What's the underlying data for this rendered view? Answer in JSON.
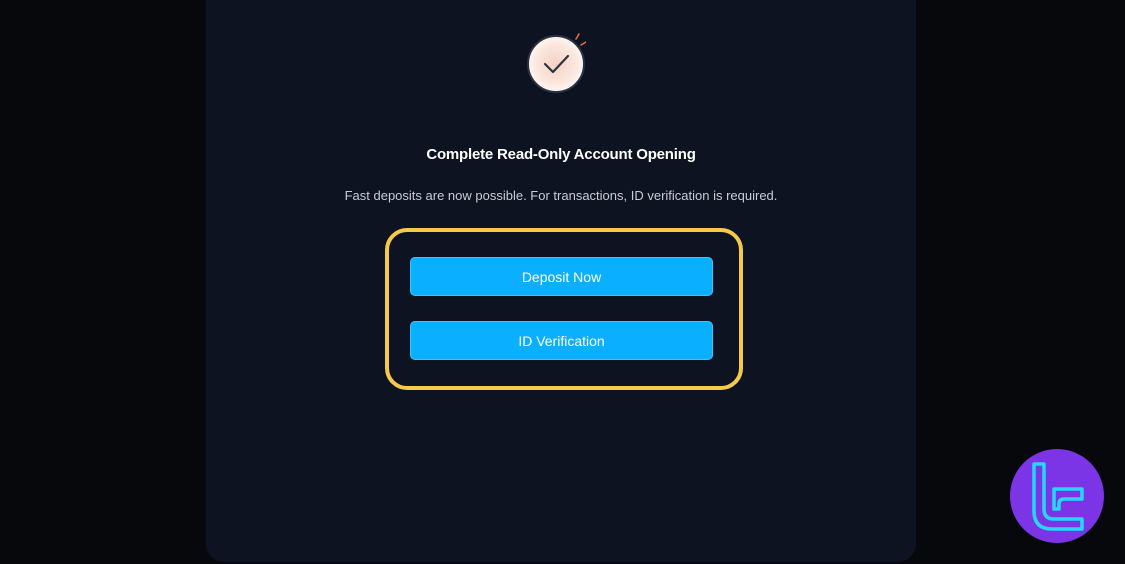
{
  "dialog": {
    "title": "Complete Read-Only Account Opening",
    "message": "Fast deposits are now possible. For transactions, ID verification is required."
  },
  "actions": {
    "deposit_label": "Deposit Now",
    "verify_label": "ID Verification"
  },
  "icons": {
    "status": "check-circle-icon",
    "brand": "brand-logo"
  },
  "colors": {
    "card_background": "#0d1321",
    "button_primary": "#0ab0ff",
    "highlight": "#f7c948",
    "logo_background": "#7b35e6",
    "logo_stroke": "#25d8ff"
  }
}
